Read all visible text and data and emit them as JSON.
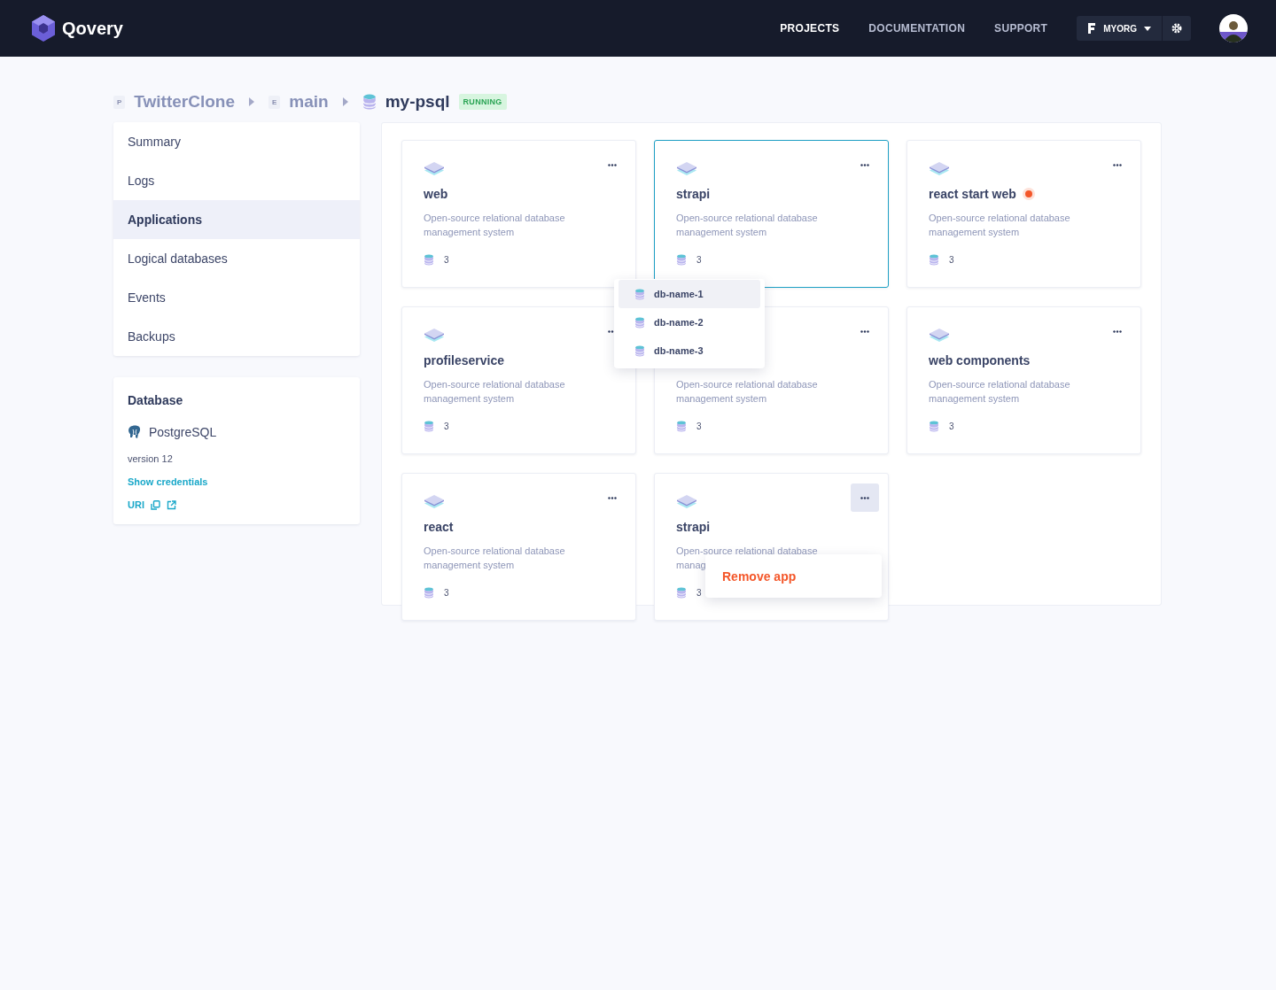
{
  "header": {
    "logo": "Qovery",
    "nav": [
      {
        "label": "PROJECTS",
        "selected": true
      },
      {
        "label": "DOCUMENTATION",
        "selected": false
      },
      {
        "label": "SUPPORT",
        "selected": false
      }
    ],
    "org": "MYORG"
  },
  "breadcrumb": {
    "project_badge": "P",
    "project": "TwitterClone",
    "env_badge": "E",
    "env": "main",
    "database": "my-psql",
    "status": "RUNNING"
  },
  "sidebar": {
    "items": [
      {
        "label": "Summary",
        "selected": false
      },
      {
        "label": "Logs",
        "selected": false
      },
      {
        "label": "Applications",
        "selected": true
      },
      {
        "label": "Logical databases",
        "selected": false
      },
      {
        "label": "Events",
        "selected": false
      },
      {
        "label": "Backups",
        "selected": false
      }
    ],
    "database": {
      "title": "Database",
      "engine": "PostgreSQL",
      "version": "version 12",
      "credentials_link": "Show credentials",
      "uri_link": "URI"
    }
  },
  "apps": [
    {
      "name": "web",
      "description": "Open-source relational database management system",
      "count": "3",
      "selected": false,
      "menu_open": false
    },
    {
      "name": "strapi",
      "description": "Open-source relational database management system",
      "count": "3",
      "selected": true,
      "menu_open": false
    },
    {
      "name": "react start web",
      "description": "Open-source relational database management system",
      "count": "3",
      "selected": false,
      "color": "#f4572a",
      "menu_open": false
    },
    {
      "name": "profileservice",
      "description": "Open-source relational database management system",
      "count": "3",
      "selected": false,
      "menu_open": false
    },
    {
      "description": "Open-source relational database management system",
      "count": "3",
      "selected": false,
      "menu_open": false
    },
    {
      "name": "web components",
      "description": "Open-source relational database management system",
      "count": "3",
      "selected": false,
      "menu_open": false
    },
    {
      "name": "react",
      "description": "Open-source relational database management system",
      "count": "3",
      "selected": false,
      "menu_open": false
    },
    {
      "name": "strapi",
      "description": "Open-source relational database manag",
      "count": "3",
      "selected": false,
      "menu_open": true
    }
  ],
  "db_dropdown": [
    {
      "label": "db-name-1",
      "selected": true
    },
    {
      "label": "db-name-2",
      "selected": false
    },
    {
      "label": "db-name-3",
      "selected": false
    }
  ],
  "app_menu": {
    "label": "Remove app"
  }
}
